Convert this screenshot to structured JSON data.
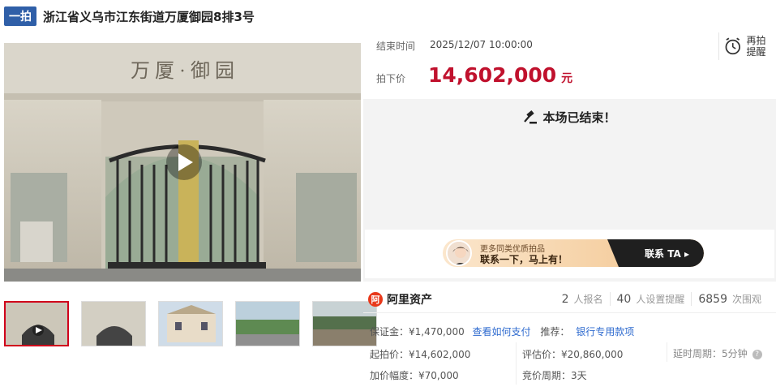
{
  "header": {
    "badge": "一拍",
    "title": "浙江省义乌市江东街道万厦御园8排3号"
  },
  "gate": {
    "sign_text": "万 厦 · 御 园"
  },
  "auction": {
    "end_label": "结束时间",
    "end_value": "2025/12/07 10:00:00",
    "price_label": "拍下价",
    "price_value": "14,602,000",
    "price_unit": "元",
    "ended_message": "本场已结束！",
    "remind_label": "再拍提醒"
  },
  "banner": {
    "line1": "更多同类优质拍品",
    "line2": "联系一下，马上有！",
    "cta": "联系 TA"
  },
  "stats": {
    "logo_text": "阿里资产",
    "logo_mark": "阿",
    "items": [
      {
        "num": "2",
        "label": "人报名"
      },
      {
        "num": "40",
        "label": "人设置提醒"
      },
      {
        "num": "6859",
        "label": "次围观"
      }
    ]
  },
  "details": {
    "deposit": "保证金：¥1,470,000",
    "how_to_pay": "查看如何支付",
    "recommend_label": "推荐：",
    "bank_account": "银行专用款项",
    "start_price": "起拍价：¥14,602,000",
    "appraisal": "评估价：¥20,860,000",
    "delay": "延时周期：5分钟",
    "increment": "加价幅度：¥70,000",
    "bid_cycle": "竞价周期：3天"
  },
  "colors": {
    "accent_red": "#c0112d",
    "badge_blue": "#2f5fa8",
    "link_blue": "#2f6bcf"
  }
}
